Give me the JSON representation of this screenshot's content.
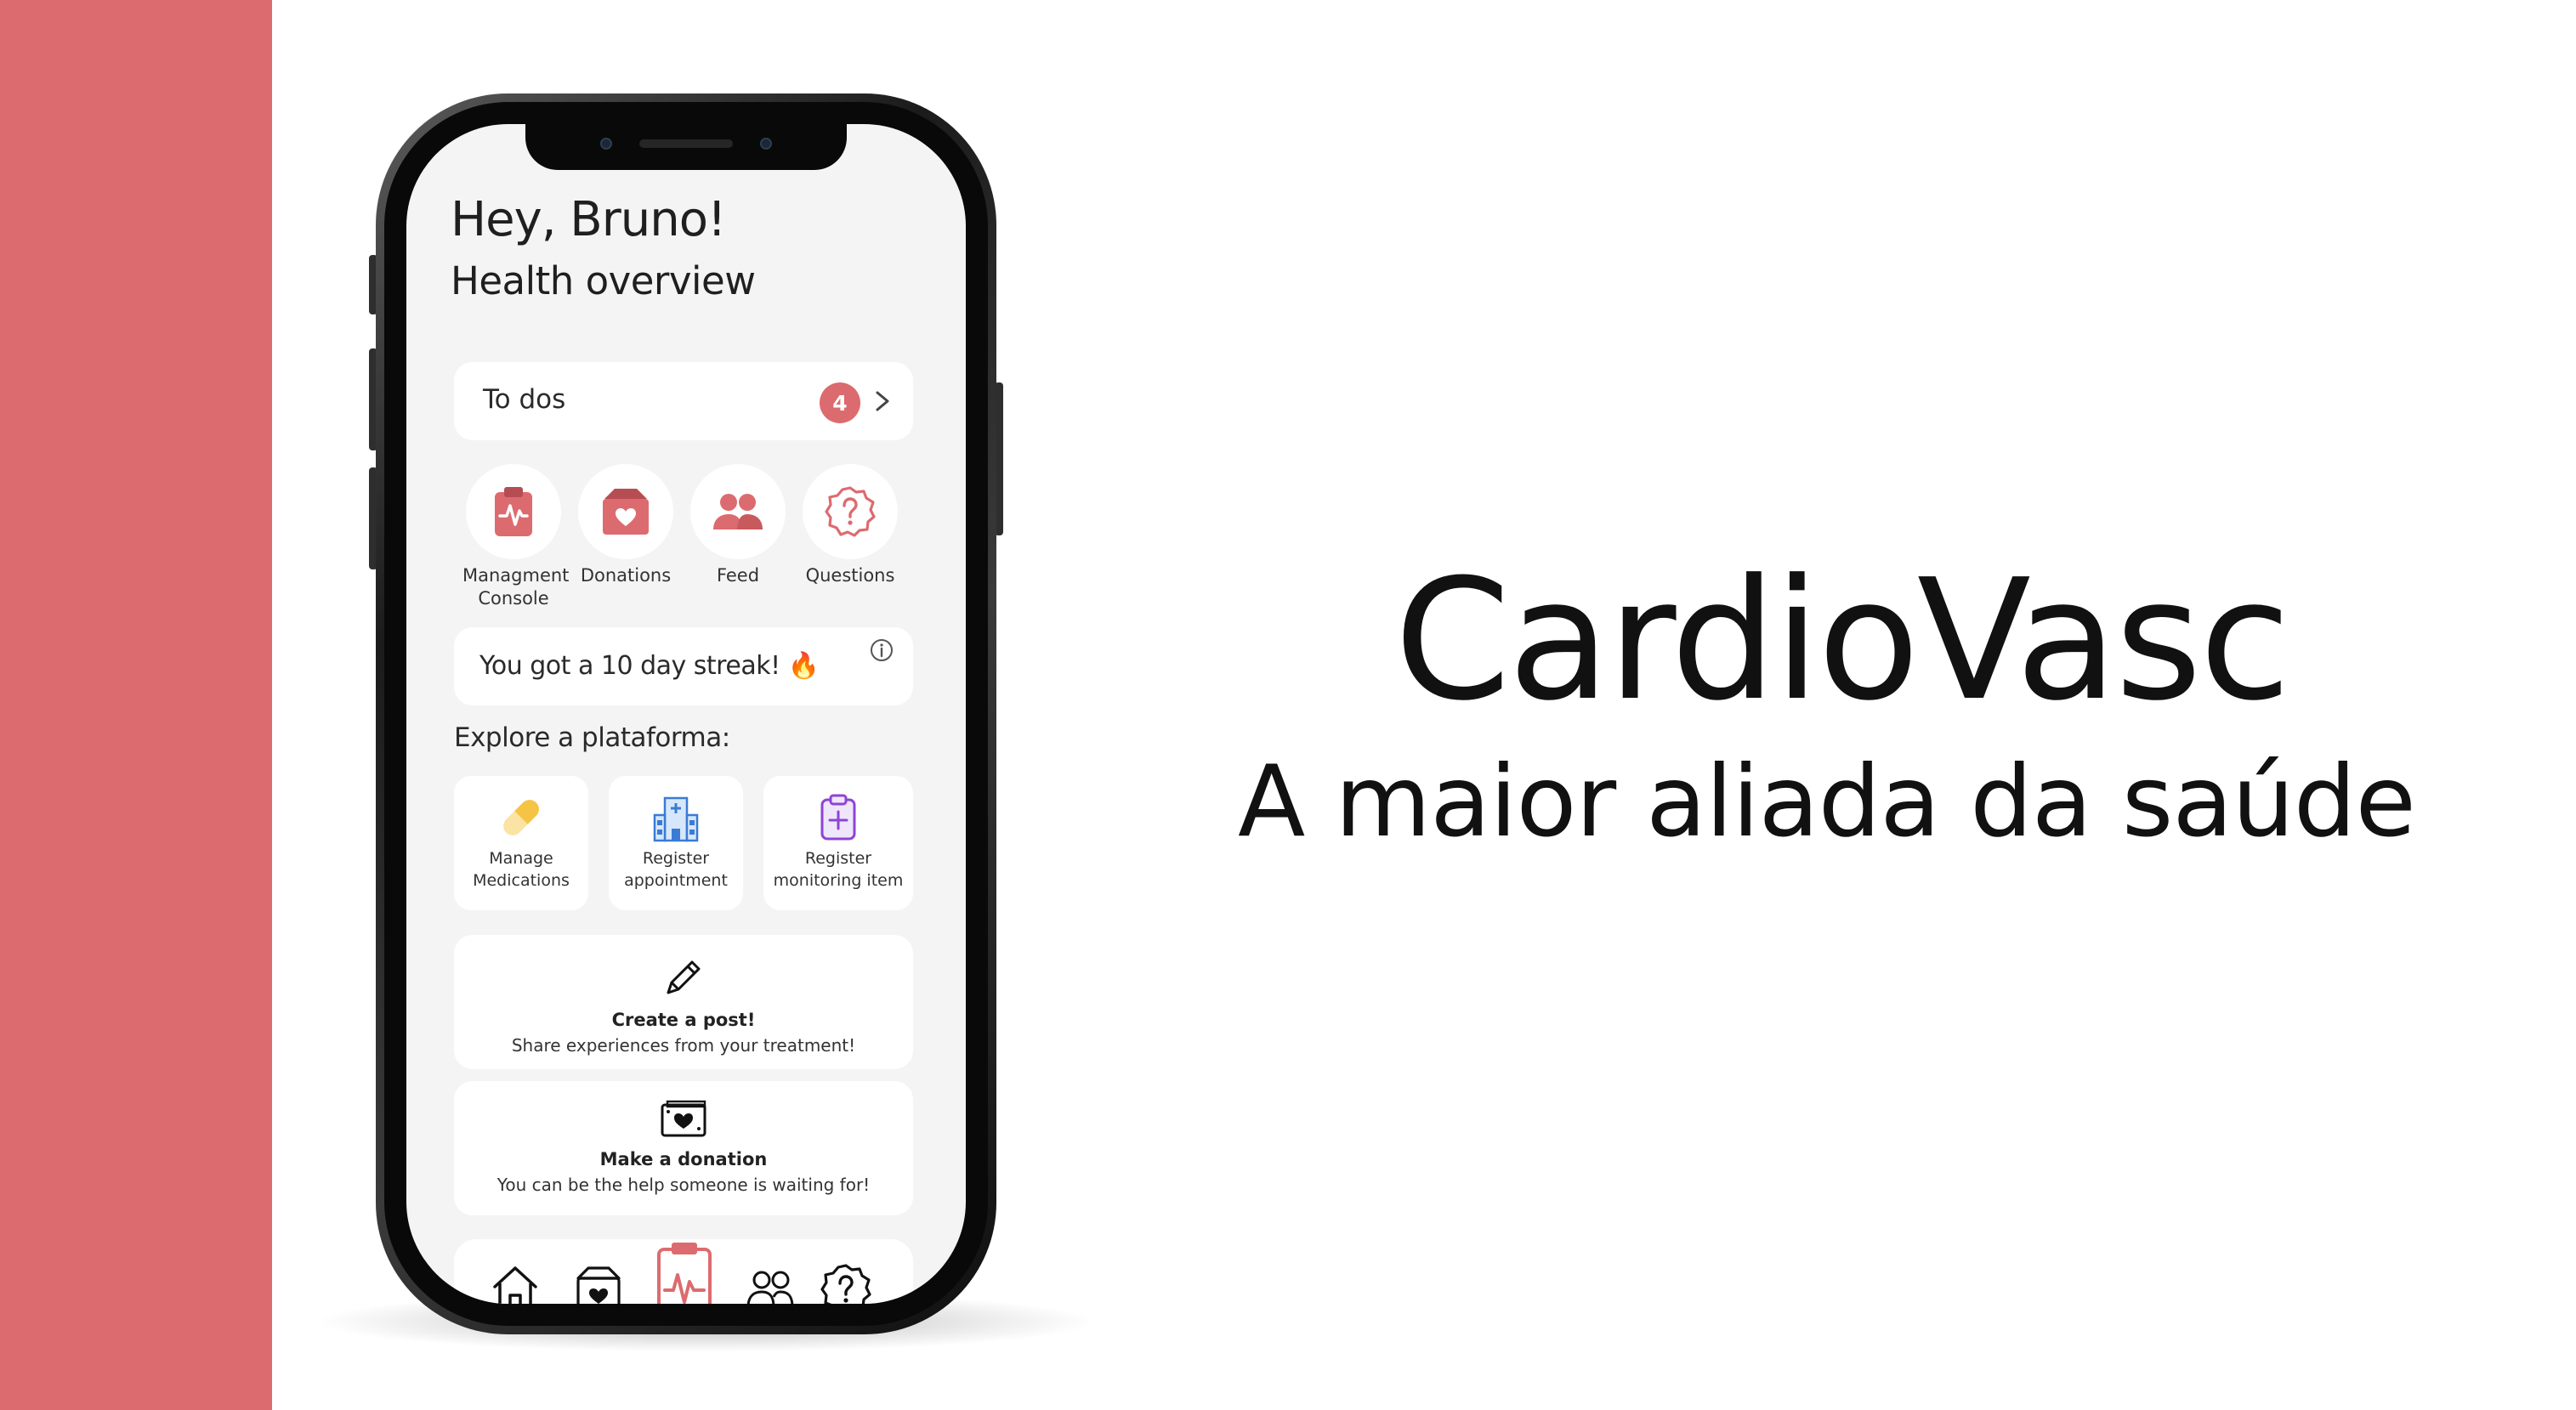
{
  "brand": {
    "name": "CardioVasc",
    "tagline": "A maior aliada da saúde",
    "accent_color": "#dc6b6f"
  },
  "app": {
    "greeting": "Hey, Bruno!",
    "subtitle": "Health overview",
    "todo": {
      "label": "To dos",
      "count": "4"
    },
    "quick_actions": [
      {
        "label": "Managment Console",
        "icon": "clipboard-heartbeat-icon"
      },
      {
        "label": "Donations",
        "icon": "donation-box-icon"
      },
      {
        "label": "Feed",
        "icon": "people-icon"
      },
      {
        "label": "Questions",
        "icon": "question-badge-icon"
      }
    ],
    "streak": {
      "text": "You got a 10 day streak! 🔥"
    },
    "explore_label": "Explore a plataforma:",
    "tiles": [
      {
        "label": "Manage Medications",
        "icon": "pill-icon"
      },
      {
        "label": "Register appointment",
        "icon": "hospital-icon"
      },
      {
        "label": "Register monitoring item",
        "icon": "clipboard-plus-icon"
      }
    ],
    "post_card": {
      "title": "Create a post!",
      "description": "Share experiences from your treatment!",
      "icon": "pencil-icon"
    },
    "donation_card": {
      "title": "Make a donation",
      "description": "You can be the help someone is waiting for!",
      "icon": "money-heart-icon"
    },
    "bottom_nav": [
      {
        "icon": "home-icon"
      },
      {
        "icon": "donation-box-icon"
      },
      {
        "icon": "clipboard-heartbeat-icon",
        "active": true
      },
      {
        "icon": "people-icon"
      },
      {
        "icon": "question-badge-icon"
      }
    ]
  }
}
